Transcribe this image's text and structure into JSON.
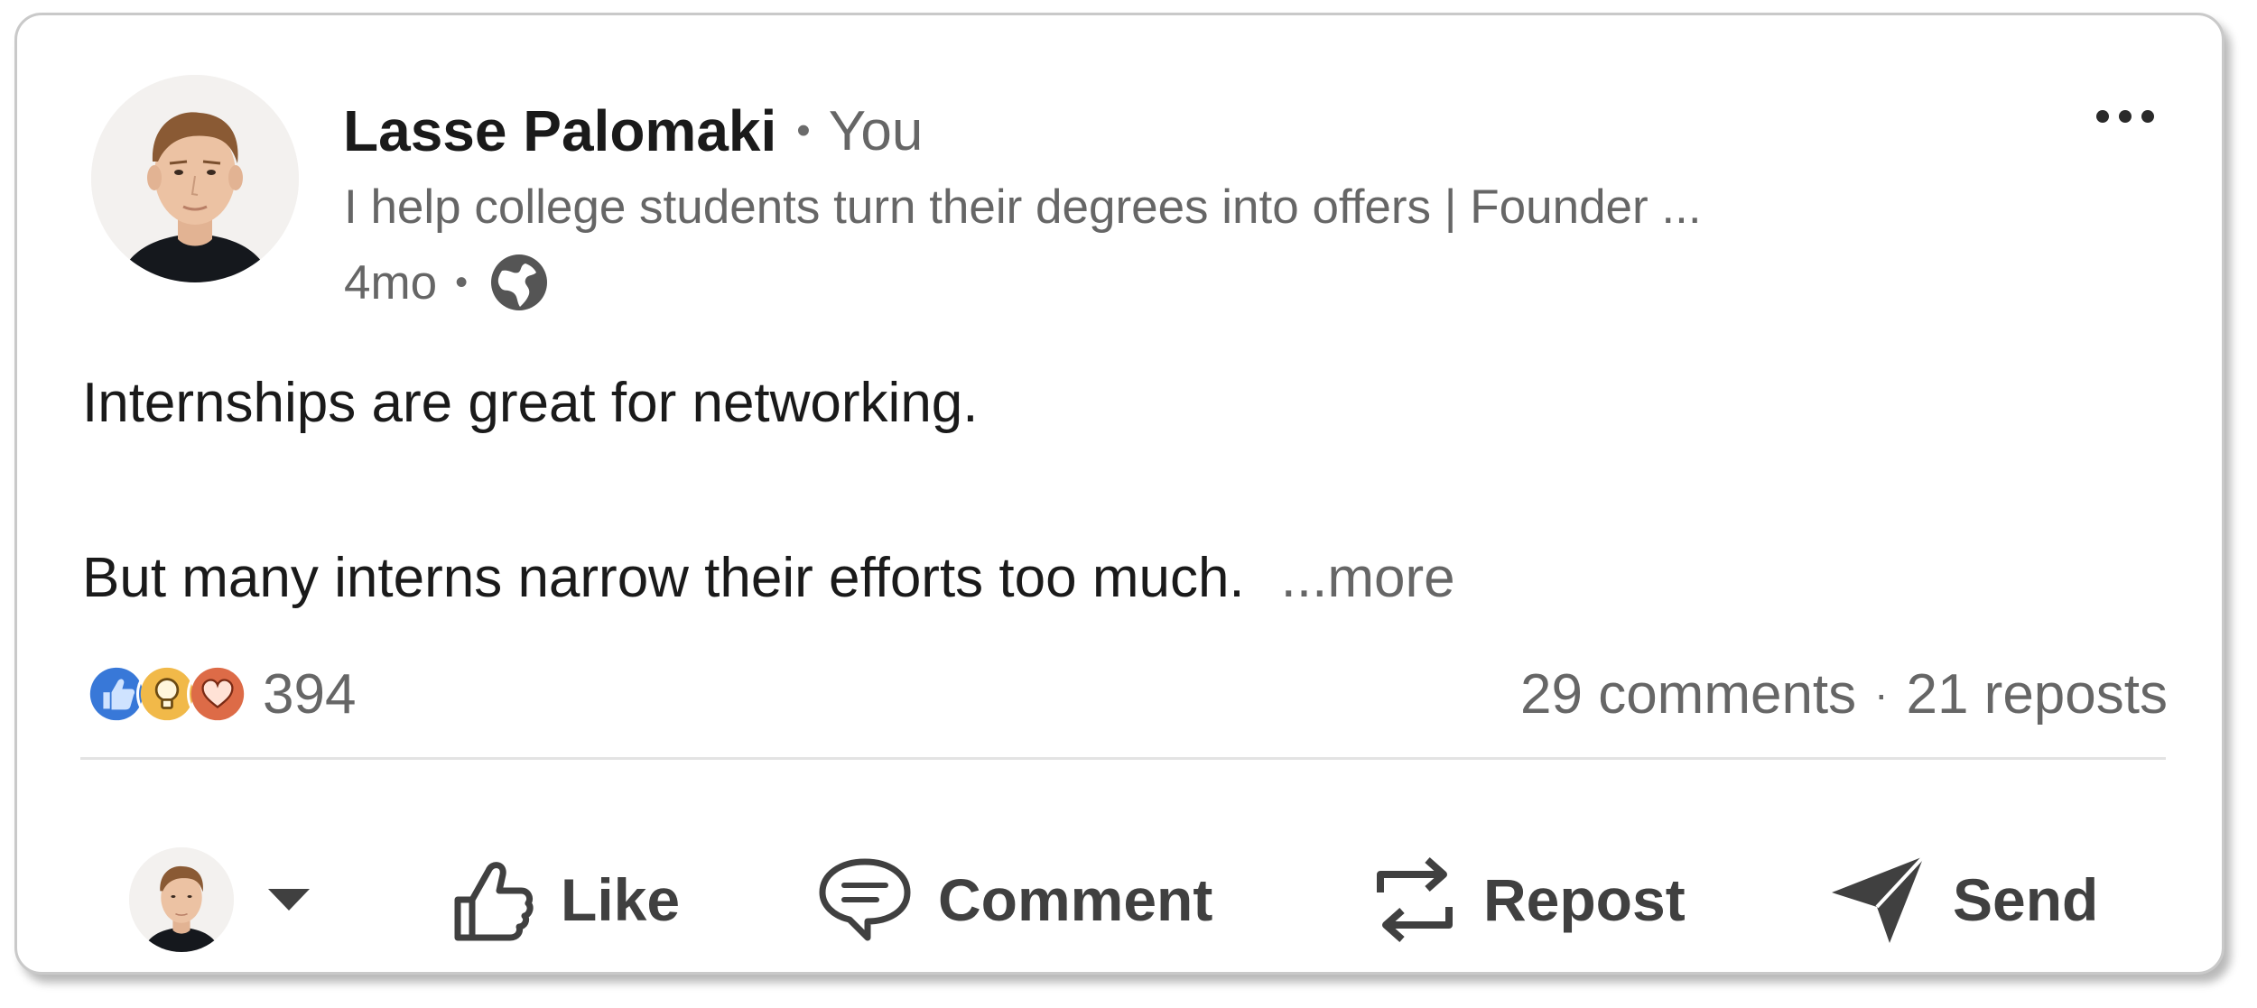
{
  "post": {
    "author": {
      "name": "Lasse Palomaki",
      "separator": "•",
      "relation": "You",
      "headline": "I help college students turn their degrees into offers | Founder ...",
      "time": "4mo",
      "meta_separator": "•",
      "visibility_icon": "globe-icon"
    },
    "menu_icon": "more-options-icon",
    "body": {
      "line1": "Internships are great for networking.",
      "line2": "But many interns narrow their efforts too much.",
      "more_label": "...more"
    },
    "social": {
      "reaction_icons": [
        "like-reaction-icon",
        "insightful-reaction-icon",
        "love-reaction-icon"
      ],
      "reaction_count": "394",
      "comments": "29 comments",
      "separator": "·",
      "reposts": "21 reposts"
    },
    "actions": {
      "actor_icon": "user-avatar",
      "caret_icon": "caret-down-icon",
      "like_label": "Like",
      "comment_label": "Comment",
      "repost_label": "Repost",
      "send_label": "Send"
    },
    "colors": {
      "like_blue": "#3878d8",
      "insightful_yellow": "#f1b949",
      "love_red": "#dd6b47",
      "text_primary": "#1a1a1a",
      "text_secondary": "#666666",
      "action_gray": "#404040"
    }
  }
}
